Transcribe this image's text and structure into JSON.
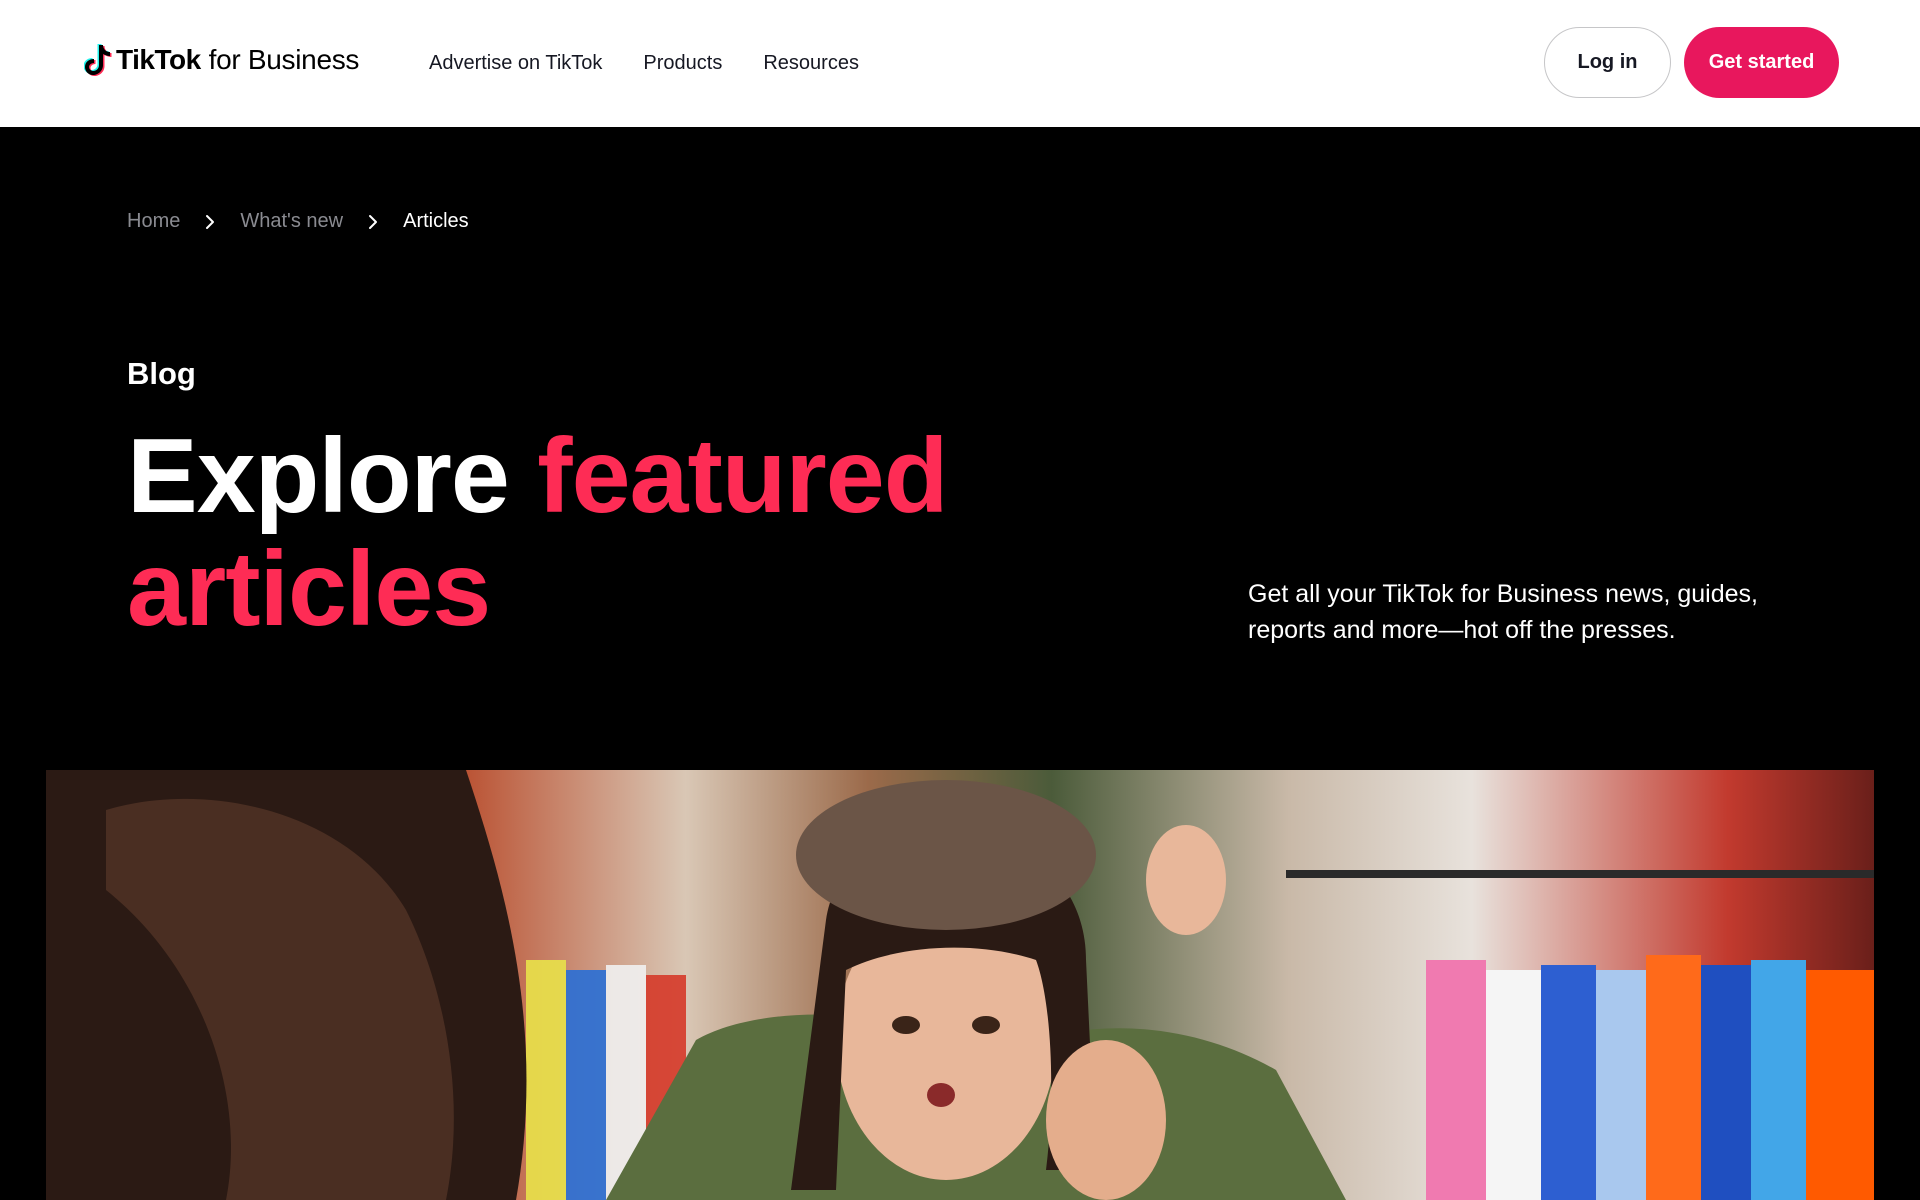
{
  "header": {
    "logo": {
      "brand": "TikTok",
      "suffix": "for Business",
      "icon": "tiktok-note-icon"
    },
    "nav": [
      "Advertise on TikTok",
      "Products",
      "Resources"
    ],
    "login_label": "Log in",
    "cta_label": "Get started"
  },
  "breadcrumb": {
    "items": [
      "Home",
      "What's new",
      "Articles"
    ],
    "separator_icon": "chevron-right-icon"
  },
  "hero": {
    "eyebrow": "Blog",
    "headline_white": "Explore",
    "headline_pink_1": "featured",
    "headline_pink_2": "articles",
    "lead": "Get all your TikTok for Business news, guides, reports and more—hot off the presses."
  },
  "colors": {
    "accent": "#fe2c55",
    "cta": "#e8175d",
    "background": "#000000",
    "header_bg": "#ffffff"
  }
}
